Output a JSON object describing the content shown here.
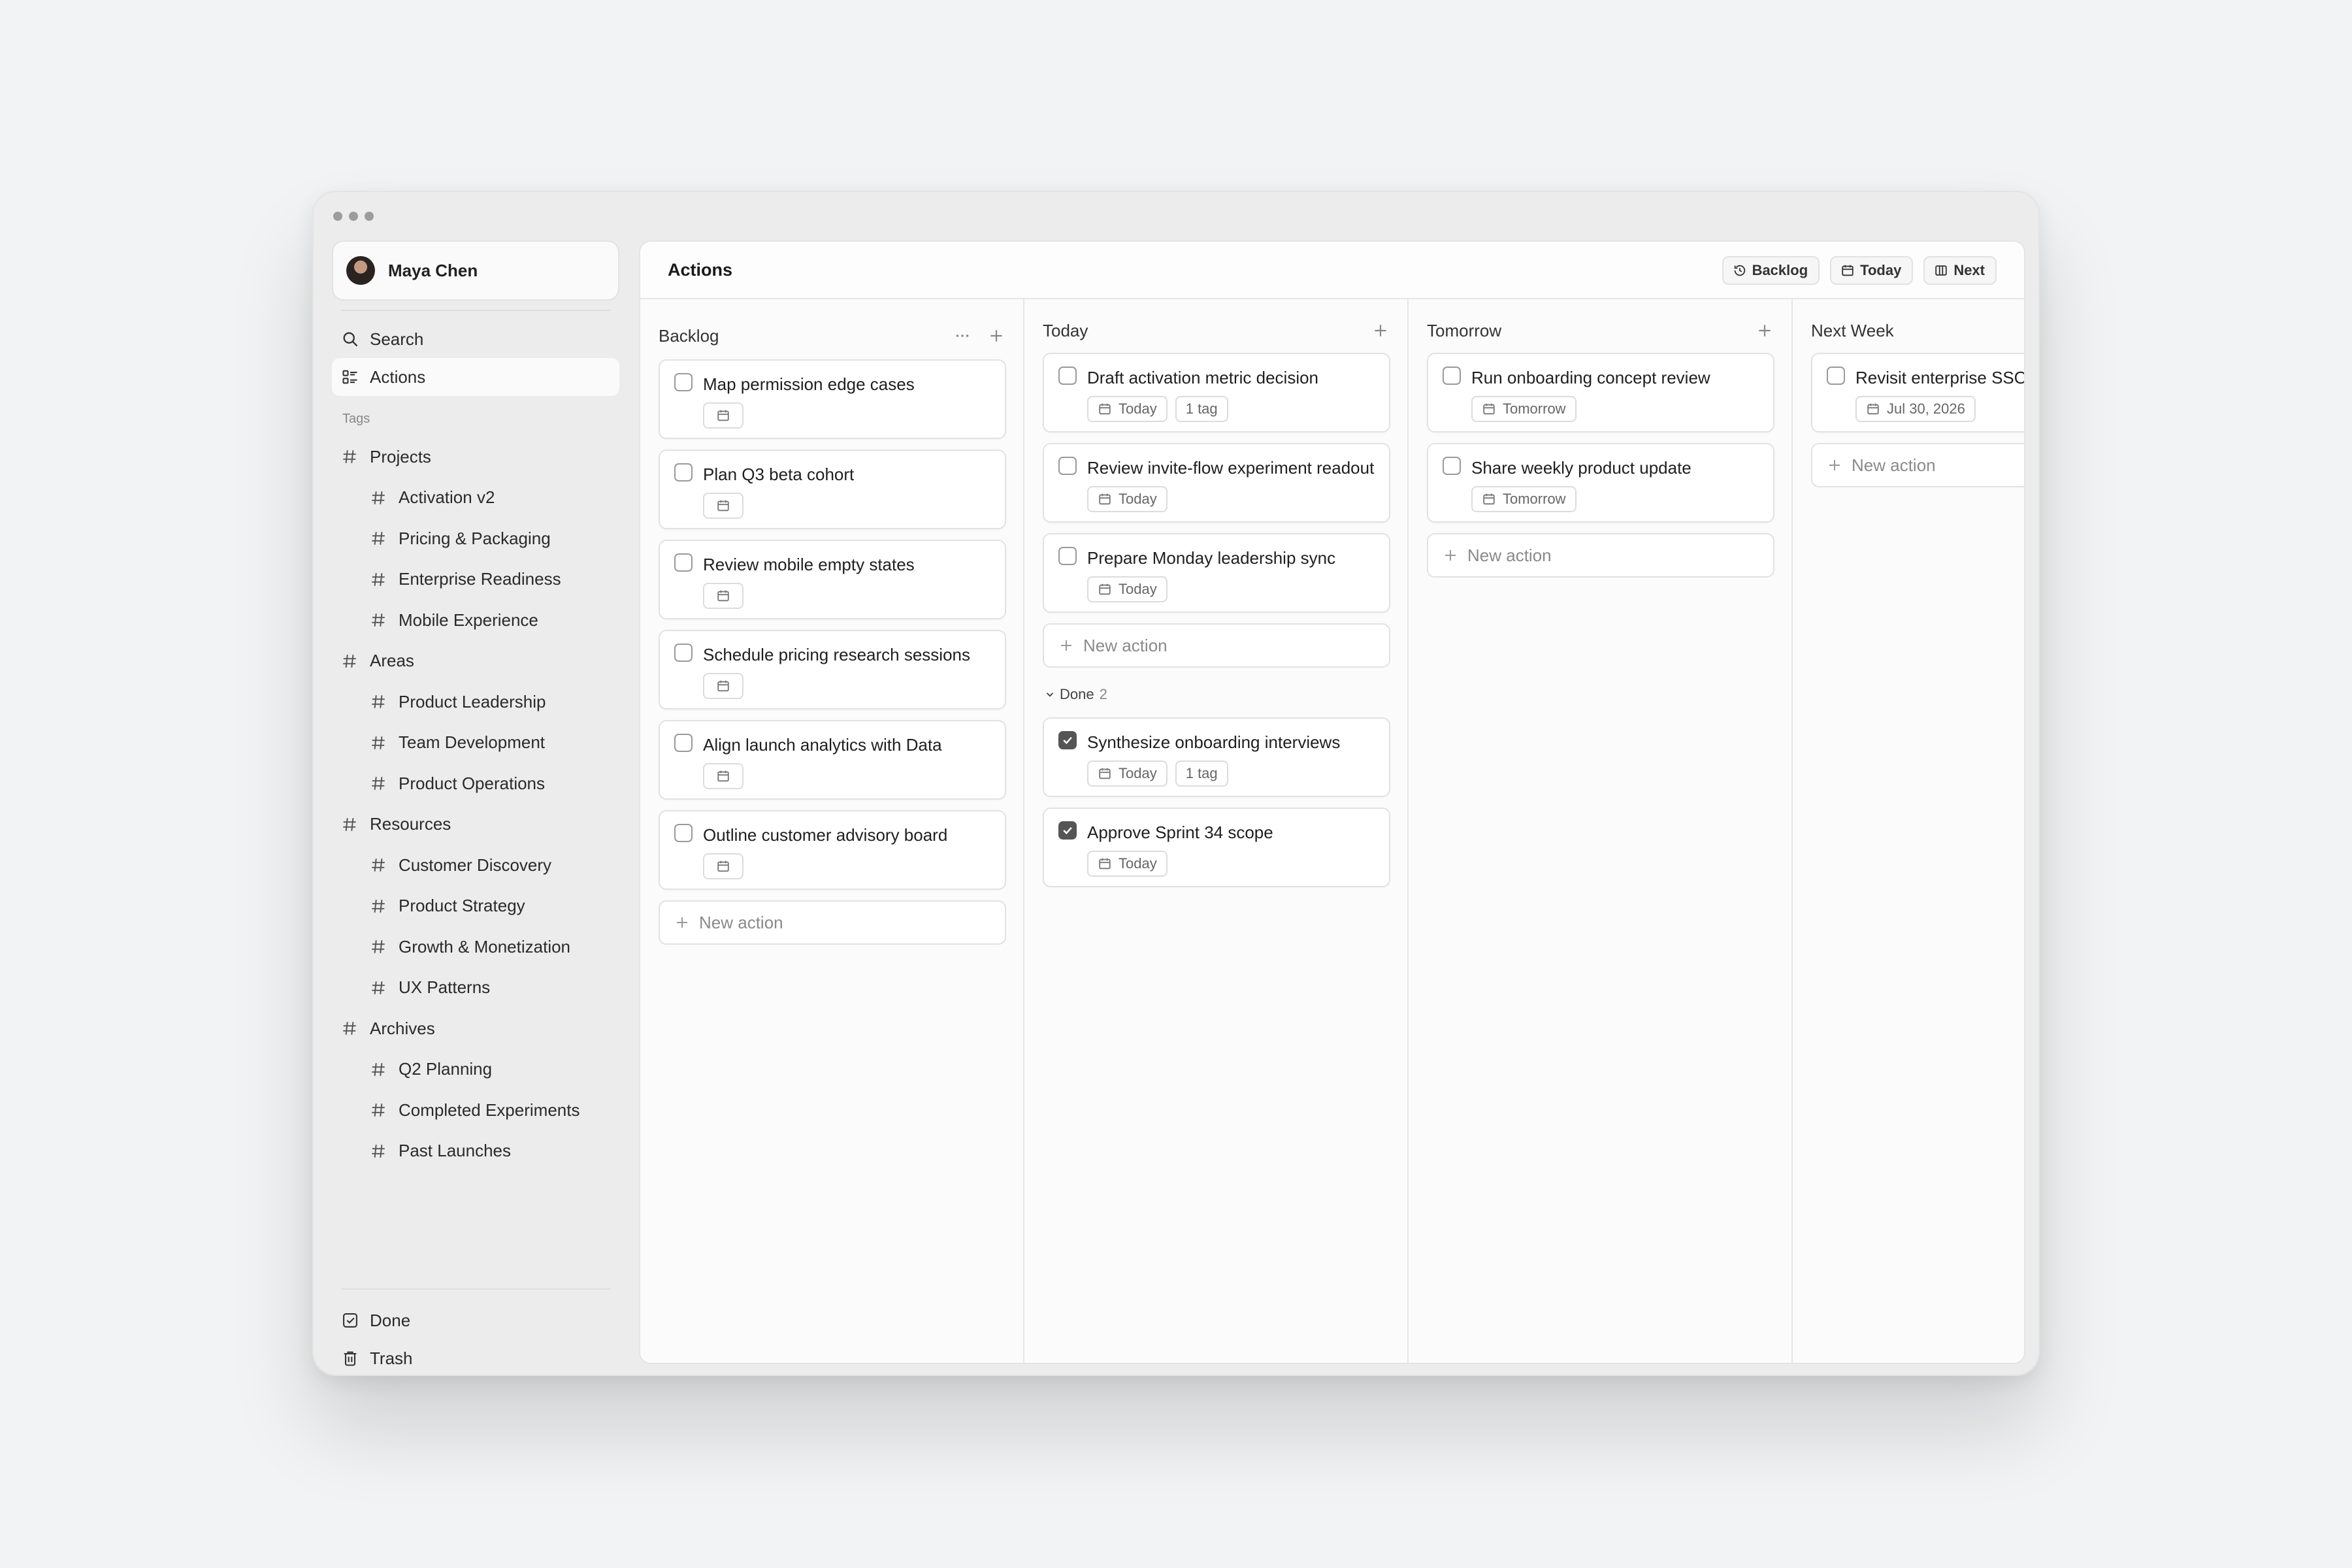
{
  "user": {
    "name": "Maya Chen"
  },
  "nav": {
    "search": "Search",
    "actions": "Actions"
  },
  "tags_label": "Tags",
  "tags": [
    {
      "label": "Projects",
      "level": 0
    },
    {
      "label": "Activation v2",
      "level": 1
    },
    {
      "label": "Pricing & Packaging",
      "level": 1
    },
    {
      "label": "Enterprise Readiness",
      "level": 1
    },
    {
      "label": "Mobile Experience",
      "level": 1
    },
    {
      "label": "Areas",
      "level": 0
    },
    {
      "label": "Product Leadership",
      "level": 1
    },
    {
      "label": "Team Development",
      "level": 1
    },
    {
      "label": "Product Operations",
      "level": 1
    },
    {
      "label": "Resources",
      "level": 0
    },
    {
      "label": "Customer Discovery",
      "level": 1
    },
    {
      "label": "Product Strategy",
      "level": 1
    },
    {
      "label": "Growth & Monetization",
      "level": 1
    },
    {
      "label": "UX Patterns",
      "level": 1
    },
    {
      "label": "Archives",
      "level": 0
    },
    {
      "label": "Q2 Planning",
      "level": 1
    },
    {
      "label": "Completed Experiments",
      "level": 1
    },
    {
      "label": "Past Launches",
      "level": 1
    }
  ],
  "bottom_nav": {
    "done": "Done",
    "trash": "Trash"
  },
  "main": {
    "title": "Actions",
    "view_tabs": {
      "backlog": "Backlog",
      "today": "Today",
      "next": "Next"
    }
  },
  "new_action_label": "New action",
  "columns": {
    "backlog": {
      "title": "Backlog",
      "cards": [
        {
          "title": "Map permission edge cases"
        },
        {
          "title": "Plan Q3 beta cohort"
        },
        {
          "title": "Review mobile empty states"
        },
        {
          "title": "Schedule pricing research sessions"
        },
        {
          "title": "Align launch analytics with Data"
        },
        {
          "title": "Outline customer advisory board"
        }
      ]
    },
    "today": {
      "title": "Today",
      "cards": [
        {
          "title": "Draft activation metric decision",
          "date": "Today",
          "tags": "1 tag"
        },
        {
          "title": "Review invite-flow experiment readout",
          "date": "Today"
        },
        {
          "title": "Prepare Monday leadership sync",
          "date": "Today"
        }
      ],
      "done_label": "Done",
      "done_count": "2",
      "done_cards": [
        {
          "title": "Synthesize onboarding interviews",
          "date": "Today",
          "tags": "1 tag"
        },
        {
          "title": "Approve Sprint 34 scope",
          "date": "Today"
        }
      ]
    },
    "tomorrow": {
      "title": "Tomorrow",
      "cards": [
        {
          "title": "Run onboarding concept review",
          "date": "Tomorrow"
        },
        {
          "title": "Share weekly product update",
          "date": "Tomorrow"
        }
      ]
    },
    "next_week": {
      "title": "Next Week",
      "cards": [
        {
          "title": "Revisit enterprise SSO",
          "date": "Jul 30, 2026"
        }
      ]
    }
  }
}
